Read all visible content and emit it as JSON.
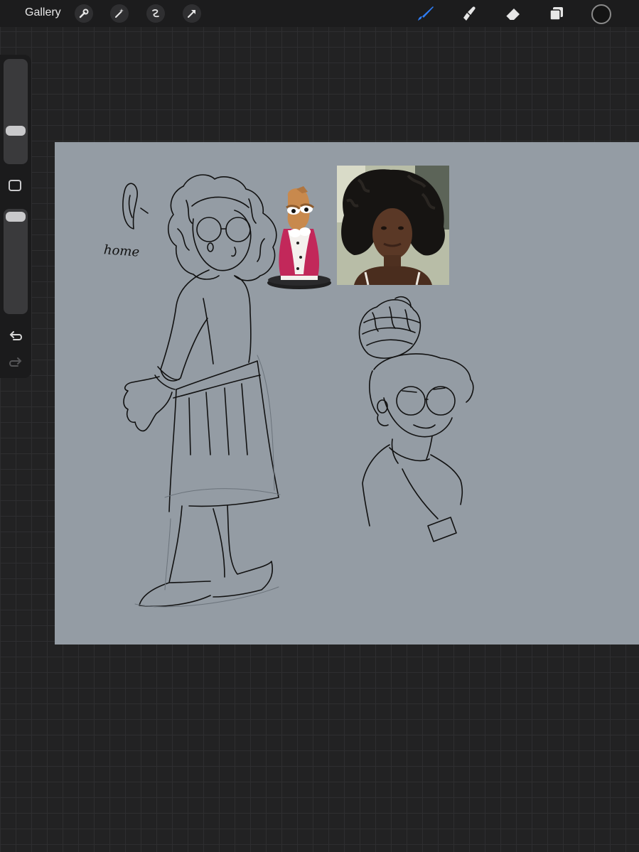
{
  "toolbar": {
    "gallery_label": "Gallery",
    "left_icons": [
      "wrench-icon",
      "magic-wand-icon",
      "selection-icon",
      "transform-arrow-icon"
    ],
    "right_icons": [
      "brush-icon",
      "smudge-icon",
      "eraser-icon",
      "layers-icon"
    ],
    "active_tool": "brush",
    "accent_color": "#2f7df6",
    "current_color": "#141414"
  },
  "sidebar": {
    "brush_size_level": 0.62,
    "opacity_level": 0.95,
    "icons": [
      "modify-square-icon",
      "undo-icon",
      "redo-icon"
    ]
  },
  "canvas": {
    "background_color": "#949ca4",
    "sketch_text": "home"
  }
}
